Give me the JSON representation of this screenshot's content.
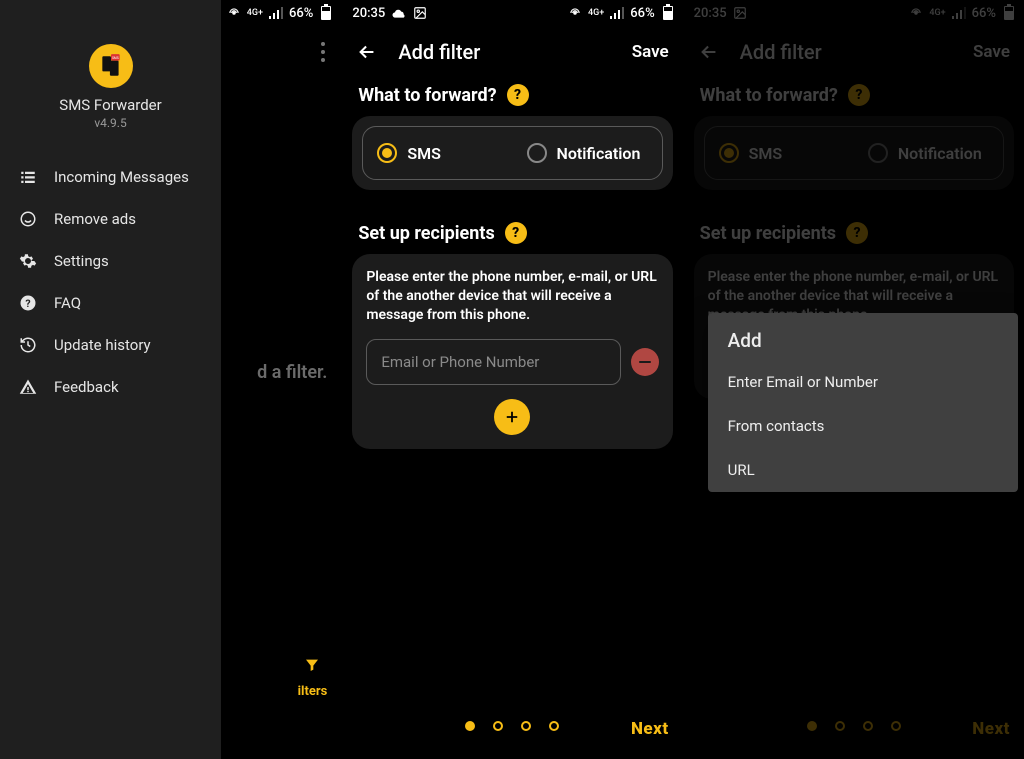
{
  "statusbar": {
    "time": "20:35",
    "battery": "66%"
  },
  "drawer": {
    "app_name": "SMS Forwarder",
    "version": "v4.9.5",
    "items": [
      {
        "label": "Incoming Messages"
      },
      {
        "label": "Remove ads"
      },
      {
        "label": "Settings"
      },
      {
        "label": "FAQ"
      },
      {
        "label": "Update history"
      },
      {
        "label": "Feedback"
      }
    ],
    "background_hint": "d a filter.",
    "background_filters_label": "ilters"
  },
  "addfilter": {
    "title": "Add filter",
    "save": "Save",
    "what_heading": "What to forward?",
    "opt_sms": "SMS",
    "opt_notification": "Notification",
    "recip_heading": "Set up recipients",
    "recip_hint": "Please enter the phone number, e-mail, or URL of the another device that will receive a message from this phone.",
    "input_placeholder": "Email or Phone Number",
    "next": "Next"
  },
  "popup": {
    "title": "Add",
    "options": [
      "Enter Email or Number",
      "From contacts",
      "URL"
    ]
  }
}
